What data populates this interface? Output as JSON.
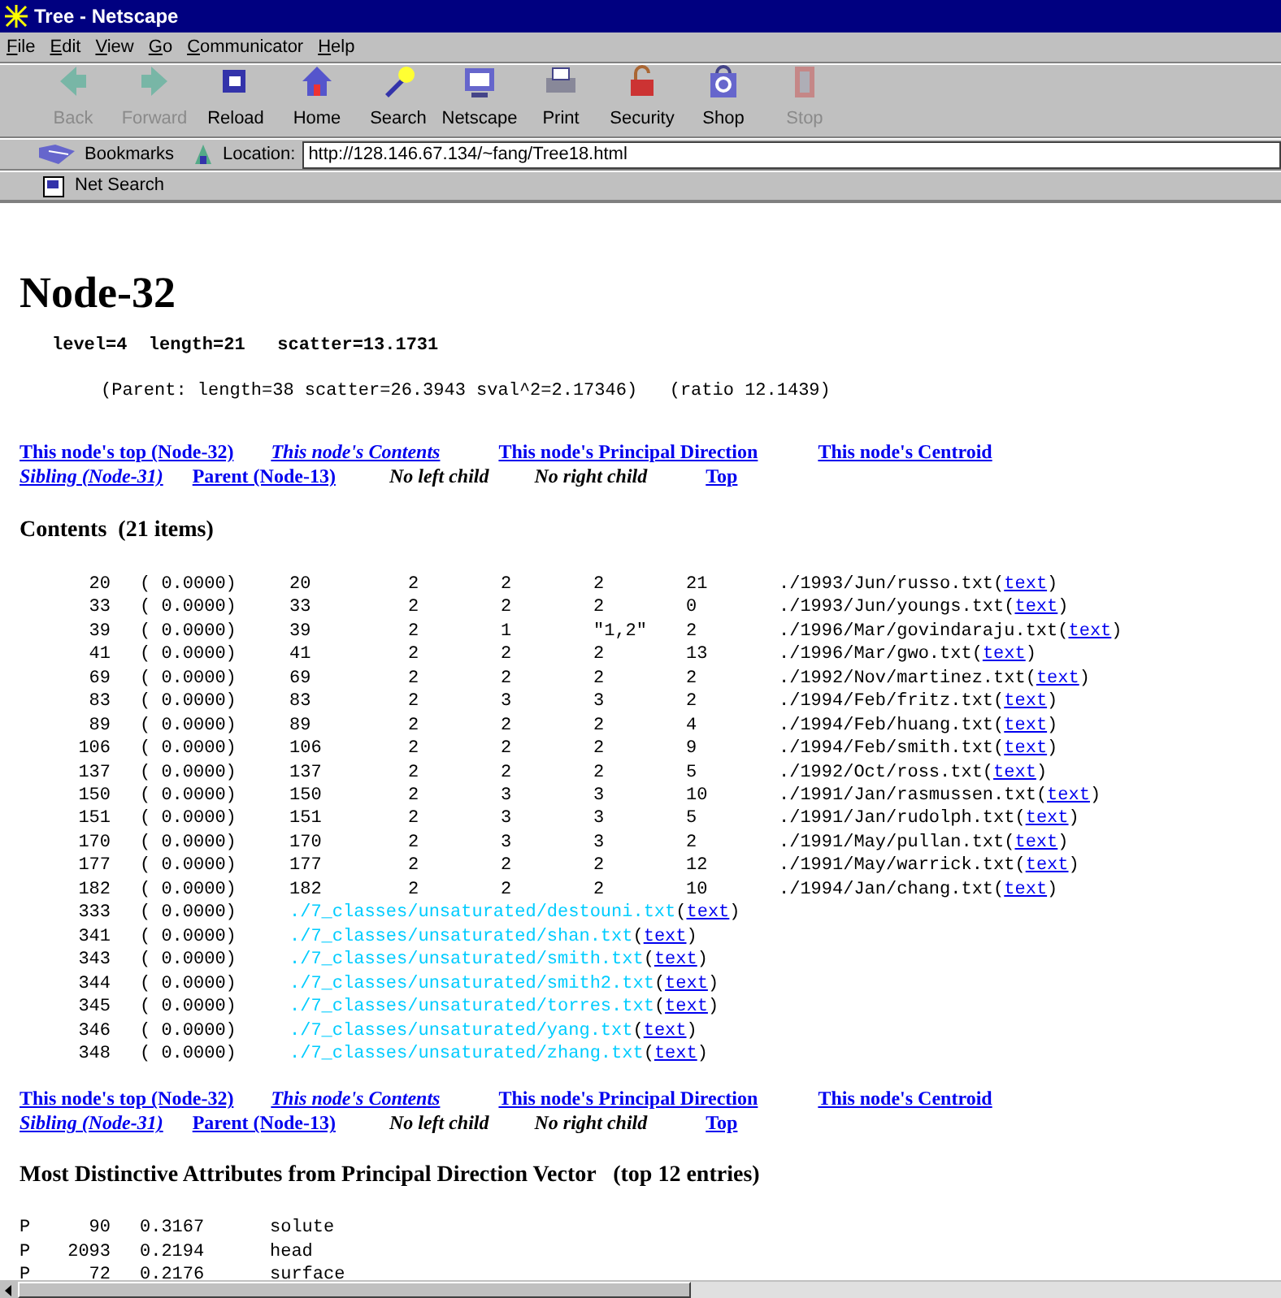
{
  "window": {
    "title": "Tree - Netscape"
  },
  "menu": [
    "File",
    "Edit",
    "View",
    "Go",
    "Communicator",
    "Help"
  ],
  "toolbar": [
    {
      "label": "Back",
      "disabled": true
    },
    {
      "label": "Forward",
      "disabled": true
    },
    {
      "label": "Reload",
      "disabled": false
    },
    {
      "label": "Home",
      "disabled": false
    },
    {
      "label": "Search",
      "disabled": false
    },
    {
      "label": "Netscape",
      "disabled": false
    },
    {
      "label": "Print",
      "disabled": false
    },
    {
      "label": "Security",
      "disabled": false
    },
    {
      "label": "Shop",
      "disabled": false
    },
    {
      "label": "Stop",
      "disabled": true
    }
  ],
  "location_bar": {
    "bookmarks": "Bookmarks",
    "label": "Location:",
    "url": "http://128.146.67.134/~fang/Tree18.html"
  },
  "personal_bar": {
    "item": "Net Search"
  },
  "page": {
    "title": "Node-32",
    "stats": "level=4  length=21   scatter=13.1731",
    "parent": "(Parent: length=38 scatter=26.3943 sval^2=2.17346)   (ratio 12.1439)",
    "nav_top": [
      [
        {
          "text": "This node's top (Node-32)",
          "kind": "link"
        },
        {
          "text": "This node's Contents",
          "kind": "current"
        },
        {
          "text": "This node's Principal Direction",
          "kind": "link"
        },
        {
          "text": "This node's Centroid",
          "kind": "link"
        }
      ],
      [
        {
          "text": "Sibling (Node-31)",
          "kind": "current"
        },
        {
          "text": "Parent (Node-13)",
          "kind": "link"
        },
        {
          "text": "No left child",
          "kind": "plain"
        },
        {
          "text": "No right child",
          "kind": "plain"
        },
        {
          "text": "Top",
          "kind": "link"
        }
      ]
    ],
    "contents_heading": "Contents  (21 items)",
    "rows": [
      {
        "kind": "file",
        "cells": [
          "20",
          "( 0.0000)",
          "20",
          "2",
          "2",
          "2",
          "21"
        ],
        "path": "./1993/Jun/russo.txt",
        "open": "(",
        "link": "text",
        "close": ")"
      },
      {
        "kind": "file",
        "cells": [
          "33",
          "( 0.0000)",
          "33",
          "2",
          "2",
          "2",
          "0"
        ],
        "path": "./1993/Jun/youngs.txt",
        "open": "(",
        "link": "text",
        "close": ")"
      },
      {
        "kind": "file",
        "cells": [
          "39",
          "( 0.0000)",
          "39",
          "2",
          "1",
          "\"1,2\"",
          "2"
        ],
        "path": "./1996/Mar/govindaraju.txt",
        "open": "(",
        "link": "text",
        "close": ")"
      },
      {
        "kind": "file",
        "cells": [
          "41",
          "( 0.0000)",
          "41",
          "2",
          "2",
          "2",
          "13"
        ],
        "path": "./1996/Mar/gwo.txt",
        "open": "(",
        "link": "text",
        "close": ")"
      },
      {
        "kind": "file",
        "cells": [
          "69",
          "( 0.0000)",
          "69",
          "2",
          "2",
          "2",
          "2"
        ],
        "path": "./1992/Nov/martinez.txt",
        "open": "(",
        "link": "text",
        "close": ")"
      },
      {
        "kind": "file",
        "cells": [
          "83",
          "( 0.0000)",
          "83",
          "2",
          "3",
          "3",
          "2"
        ],
        "path": "./1994/Feb/fritz.txt",
        "open": "(",
        "link": "text",
        "close": ")"
      },
      {
        "kind": "file",
        "cells": [
          "89",
          "( 0.0000)",
          "89",
          "2",
          "2",
          "2",
          "4"
        ],
        "path": "./1994/Feb/huang.txt",
        "open": "(",
        "link": "text",
        "close": ")"
      },
      {
        "kind": "file",
        "cells": [
          "106",
          "( 0.0000)",
          "106",
          "2",
          "2",
          "2",
          "9"
        ],
        "path": "./1994/Feb/smith.txt",
        "open": "(",
        "link": "text",
        "close": ")"
      },
      {
        "kind": "file",
        "cells": [
          "137",
          "( 0.0000)",
          "137",
          "2",
          "2",
          "2",
          "5"
        ],
        "path": "./1992/Oct/ross.txt",
        "open": "(",
        "link": "text",
        "close": ")"
      },
      {
        "kind": "file",
        "cells": [
          "150",
          "( 0.0000)",
          "150",
          "2",
          "3",
          "3",
          "10"
        ],
        "path": "./1991/Jan/rasmussen.txt",
        "open": "(",
        "link": "text",
        "close": ")"
      },
      {
        "kind": "file",
        "cells": [
          "151",
          "( 0.0000)",
          "151",
          "2",
          "3",
          "3",
          "5"
        ],
        "path": "./1991/Jan/rudolph.txt",
        "open": "(",
        "link": "text",
        "close": ")"
      },
      {
        "kind": "file",
        "cells": [
          "170",
          "( 0.0000)",
          "170",
          "2",
          "3",
          "3",
          "2"
        ],
        "path": "./1991/May/pullan.txt",
        "open": "(",
        "link": "text",
        "close": ")"
      },
      {
        "kind": "file",
        "cells": [
          "177",
          "( 0.0000)",
          "177",
          "2",
          "2",
          "2",
          "12"
        ],
        "path": "./1991/May/warrick.txt",
        "open": "(",
        "link": "text",
        "close": ")"
      },
      {
        "kind": "file",
        "cells": [
          "182",
          "( 0.0000)",
          "182",
          "2",
          "2",
          "2",
          "10"
        ],
        "path": "./1994/Jan/chang.txt",
        "open": "(",
        "link": "text",
        "close": ")"
      },
      {
        "kind": "class",
        "cells": [
          "333",
          "( 0.0000)"
        ],
        "path": "./7_classes/unsaturated/destouni.txt",
        "open": "(",
        "link": "text",
        "close": ")"
      },
      {
        "kind": "class",
        "cells": [
          "341",
          "( 0.0000)"
        ],
        "path": "./7_classes/unsaturated/shan.txt",
        "open": "(",
        "link": "text",
        "close": ")"
      },
      {
        "kind": "class",
        "cells": [
          "343",
          "( 0.0000)"
        ],
        "path": "./7_classes/unsaturated/smith.txt",
        "open": "(",
        "link": "text",
        "close": ")"
      },
      {
        "kind": "class",
        "cells": [
          "344",
          "( 0.0000)"
        ],
        "path": "./7_classes/unsaturated/smith2.txt",
        "open": "(",
        "link": "text",
        "close": ")"
      },
      {
        "kind": "class",
        "cells": [
          "345",
          "( 0.0000)"
        ],
        "path": "./7_classes/unsaturated/torres.txt",
        "open": "(",
        "link": "text",
        "close": ")"
      },
      {
        "kind": "class",
        "cells": [
          "346",
          "( 0.0000)"
        ],
        "path": "./7_classes/unsaturated/yang.txt",
        "open": "(",
        "link": "text",
        "close": ")"
      },
      {
        "kind": "class",
        "cells": [
          "348",
          "( 0.0000)"
        ],
        "path": "./7_classes/unsaturated/zhang.txt",
        "open": "(",
        "link": "text",
        "close": ")"
      }
    ],
    "nav_bottom": [
      [
        {
          "text": "This node's top (Node-32)",
          "kind": "link"
        },
        {
          "text": "This node's Contents",
          "kind": "current"
        },
        {
          "text": "This node's Principal Direction",
          "kind": "link"
        },
        {
          "text": "This node's Centroid",
          "kind": "link"
        }
      ],
      [
        {
          "text": "Sibling (Node-31)",
          "kind": "current"
        },
        {
          "text": "Parent (Node-13)",
          "kind": "link"
        },
        {
          "text": "No left child",
          "kind": "plain"
        },
        {
          "text": "No right child",
          "kind": "plain"
        },
        {
          "text": "Top",
          "kind": "link"
        }
      ]
    ],
    "attributes_heading": "Most Distinctive Attributes from Principal Direction Vector   (top 12 entries)",
    "attributes": [
      [
        "P",
        "90",
        "0.3167",
        "solute"
      ],
      [
        "P",
        "2093",
        "0.2194",
        "head"
      ],
      [
        "P",
        "72",
        "0.2176",
        "surface"
      ]
    ]
  }
}
